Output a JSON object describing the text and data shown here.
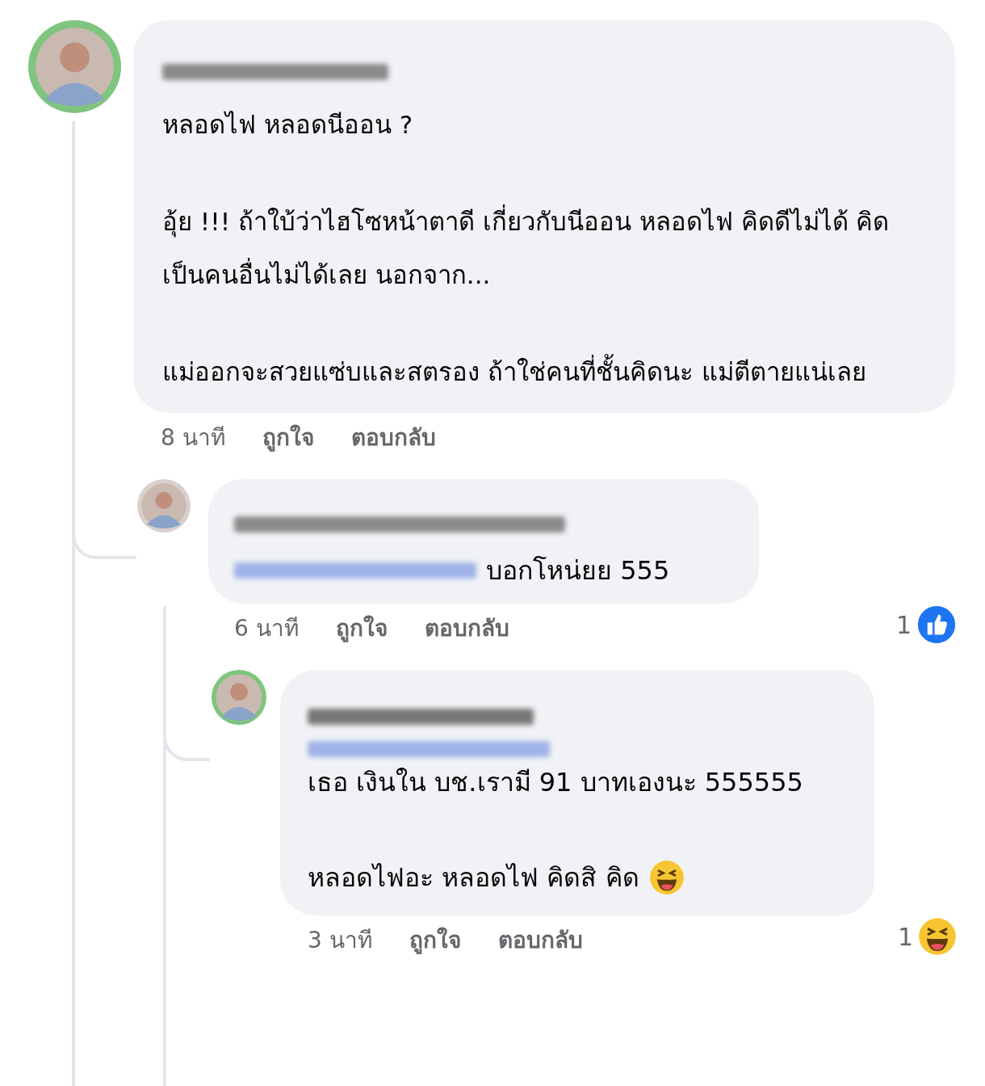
{
  "comment": {
    "paragraphs": [
      "หลอดไฟ หลอดนีออน ?",
      "อุ้ย !!! ถ้าใบ้ว่าไฮโซหน้าตาดี เกี่ยวกับนีออน หลอดไฟ คิดดีไม่ได้ คิดเป็นคนอื่นไม่ได้เลย นอกจาก...",
      "แม่ออกจะสวยแซ่บและสตรอง  ถ้าใช่คนที่ชั้นคิดนะ แม่ตีตายแน่เลย"
    ],
    "time": "8 นาที",
    "actions": [
      "ถูกใจ",
      "ตอบกลับ"
    ],
    "replies": [
      {
        "mention": true,
        "paragraphs": [
          "บอกโหน่ยย 555"
        ],
        "kind": "plain",
        "time": "6 นาที",
        "actions": [
          "ถูกใจ",
          "ตอบกลับ"
        ],
        "reaction": {
          "kind": "like",
          "count": "1"
        }
      },
      {
        "mention": true,
        "paragraphs": [
          "เธอ เงินใน บช.เรามี 91 บาทเองนะ 555555",
          "หลอดไฟอะ หลอดไฟ คิดสิ คิด"
        ],
        "kind": "emoji_end",
        "time": "3 นาที",
        "actions": [
          "ถูกใจ",
          "ตอบกลับ"
        ],
        "reaction": {
          "kind": "haha",
          "count": "1"
        }
      }
    ]
  }
}
